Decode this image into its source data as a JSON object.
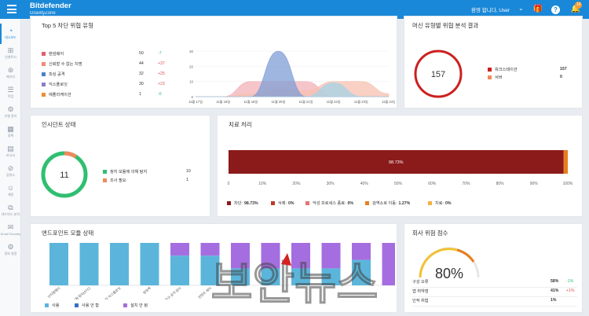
{
  "app": {
    "brand": "Bitdefender",
    "product": "GravityZone",
    "user": "환영 합니다, User",
    "notif_count": "14"
  },
  "sidebar": {
    "items": [
      {
        "label": "대시보드",
        "icon": "dashboard-icon"
      },
      {
        "label": "인벤토리",
        "icon": "network-icon"
      },
      {
        "label": "패키지",
        "icon": "packages-icon"
      },
      {
        "label": "작업",
        "icon": "tasks-icon"
      },
      {
        "label": "유형 관리",
        "icon": "policies-icon"
      },
      {
        "label": "정책",
        "icon": "policy-icon"
      },
      {
        "label": "보고서",
        "icon": "reports-icon"
      },
      {
        "label": "검역소",
        "icon": "quarantine-icon"
      },
      {
        "label": "계정",
        "icon": "accounts-icon"
      },
      {
        "label": "샌드박스 분석",
        "icon": "sandbox-icon"
      },
      {
        "label": "Email Security",
        "icon": "email-icon"
      },
      {
        "label": "정보 설정",
        "icon": "settings-icon"
      }
    ]
  },
  "threats": {
    "title": "Top 5 차단 위협 유형",
    "rows": [
      {
        "name": "랜섬웨어",
        "count": "50",
        "change": "-7",
        "color": "#e05f6d"
      },
      {
        "name": "신뢰할 수 없는 치명",
        "count": "44",
        "change": "+37",
        "color": "#f08a75"
      },
      {
        "name": "피싱 공격",
        "count": "32",
        "change": "+25",
        "color": "#4e7fc8"
      },
      {
        "name": "익스플로잇",
        "count": "30",
        "change": "+23",
        "color": "#8a7fc6"
      },
      {
        "name": "애플리케이션",
        "count": "1",
        "change": "-6",
        "color": "#f08c34"
      }
    ]
  },
  "threat_chart": {
    "chart_data": {
      "type": "area",
      "categories": [
        "11월 17일",
        "11월 18일",
        "11월 19일",
        "11월 20일",
        "11월 21일",
        "11월 22일",
        "11월 23일",
        "11월 24일"
      ],
      "ylim": [
        0,
        30
      ],
      "yticks": [
        "0",
        "10",
        "20",
        "30"
      ],
      "series": [
        {
          "name": "랜섬웨어",
          "color": "#f3b2b8",
          "values": [
            0,
            0,
            10,
            10,
            10,
            0,
            0,
            0
          ]
        },
        {
          "name": "신뢰할 수 없는 치명",
          "color": "#f5c0b0",
          "values": [
            0,
            0,
            2,
            5,
            4,
            10,
            10,
            2
          ]
        },
        {
          "name": "피싱 공격",
          "color": "#7f9ed6",
          "values": [
            0,
            0,
            0,
            30,
            0,
            0,
            0,
            0
          ]
        },
        {
          "name": "익스플로잇",
          "color": "#a5d3e6",
          "values": [
            0,
            0,
            0,
            0,
            0,
            9,
            0,
            0
          ]
        }
      ]
    }
  },
  "machine": {
    "title": "머신 유형별 위협 분석 결과",
    "total": "157",
    "rows": [
      {
        "name": "워크스테이션",
        "value": "157",
        "color": "#cc2020"
      },
      {
        "name": "서버",
        "value": "0",
        "color": "#f08a5d"
      }
    ]
  },
  "incidents": {
    "title": "인시던트 상태",
    "total": "11",
    "rows": [
      {
        "name": "정지 모듈에 의해 탐지",
        "value": "10",
        "color": "#2fbf71"
      },
      {
        "name": "조사 필요",
        "value": "1",
        "color": "#f08a5d"
      }
    ]
  },
  "remediation": {
    "title": "치료 처리",
    "chart_data": {
      "type": "bar",
      "values": [
        98.73,
        1.27
      ],
      "bar_label": "98.73%",
      "xticks": [
        "0",
        "10%",
        "20%",
        "30%",
        "40%",
        "50%",
        "60%",
        "70%",
        "80%",
        "90%",
        "100%"
      ]
    },
    "legend": [
      {
        "name": "차단:",
        "value": "98.73%",
        "color": "#8b1a1a"
      },
      {
        "name": "삭제:",
        "value": "0%",
        "color": "#c0392b"
      },
      {
        "name": "악성 프로세스 종료:",
        "value": "0%",
        "color": "#e57373"
      },
      {
        "name": "검역소로 이동:",
        "value": "1.27%",
        "color": "#e67e22"
      },
      {
        "name": "치료:",
        "value": "0%",
        "color": "#f5b041"
      }
    ]
  },
  "modules": {
    "title": "엔드포인트 모듈 상태",
    "chart_data": {
      "type": "bar",
      "categories": [
        "안티멀웨어",
        "고급 위협 탐지(ATC)",
        "안티 익스플로잇",
        "방화벽",
        "네트워크 공격 방어",
        "컨텐츠 제어",
        "",
        "",
        "",
        "",
        "",
        ""
      ],
      "series": [
        {
          "name": "사용",
          "color": "#5bb5db",
          "values": [
            100,
            100,
            100,
            100,
            70,
            70,
            40,
            40,
            40,
            40,
            60,
            0
          ]
        },
        {
          "name": "사용 안 함",
          "color": "#3b6fc4",
          "values": [
            0,
            0,
            0,
            0,
            0,
            0,
            0,
            0,
            0,
            0,
            0,
            0
          ]
        },
        {
          "name": "설치 안 됨",
          "color": "#a56ee0",
          "values": [
            0,
            0,
            0,
            0,
            30,
            30,
            60,
            60,
            60,
            60,
            40,
            100
          ]
        }
      ]
    }
  },
  "risk": {
    "title": "회사 위험 점수",
    "score": "80%",
    "rows": [
      {
        "name": "구성 오류",
        "value": "58%",
        "change": "-1%",
        "cc": "#2fbf71"
      },
      {
        "name": "앱 취약점",
        "value": "41%",
        "change": "+1%",
        "cc": "#e05050"
      },
      {
        "name": "인적 위험",
        "value": "1%",
        "change": "",
        "cc": "#333"
      }
    ]
  },
  "watermark": "보안뉴스"
}
